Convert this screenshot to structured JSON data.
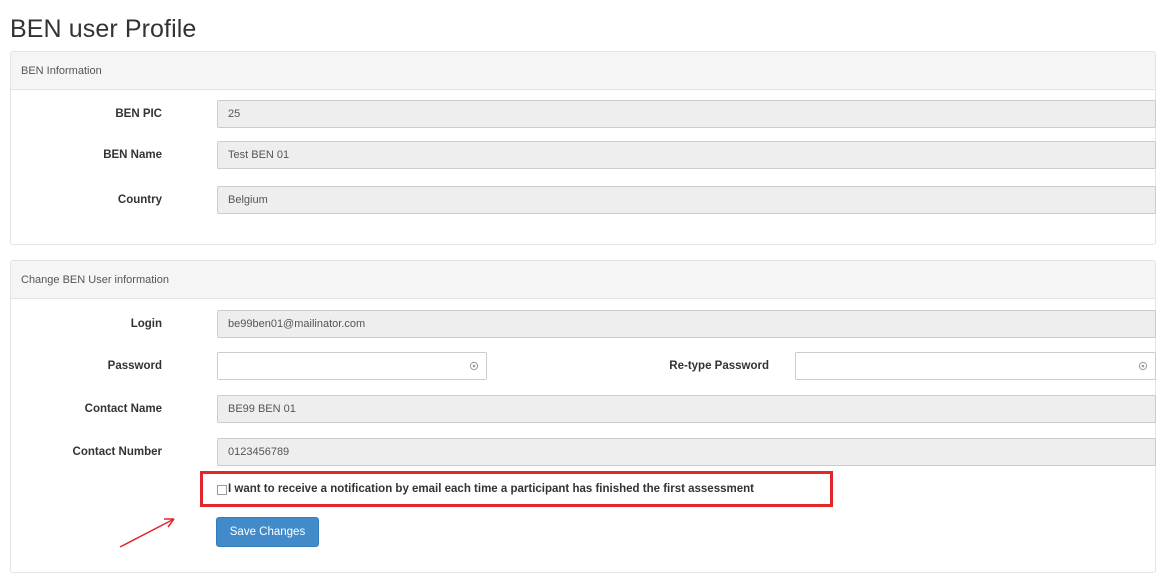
{
  "page": {
    "title": "BEN user Profile"
  },
  "ben_info": {
    "heading": "BEN Information",
    "fields": [
      {
        "label": "BEN PIC",
        "value": "25"
      },
      {
        "label": "BEN Name",
        "value": "Test BEN 01"
      },
      {
        "label": "Country",
        "value": "Belgium"
      }
    ]
  },
  "user_info": {
    "heading": "Change BEN User information",
    "login": {
      "label": "Login",
      "value": "be99ben01@mailinator.com"
    },
    "password": {
      "label": "Password",
      "value": ""
    },
    "retype_password": {
      "label": "Re-type Password",
      "value": ""
    },
    "contact_name": {
      "label": "Contact Name",
      "value": "BE99 BEN 01"
    },
    "contact_number": {
      "label": "Contact Number",
      "value": "0123456789"
    },
    "notification": {
      "label": "I want to receive a notification by email each time a participant has finished the first assessment",
      "checked": false
    },
    "save_label": "Save Changes"
  },
  "colors": {
    "accent": "#428bca",
    "highlight_box": "#e2262a",
    "readonly_bg": "#eeeeee",
    "panel_heading_bg": "#f5f5f5"
  },
  "icons": {
    "password_toggle": "eye-icon",
    "annotation": "red-arrow"
  }
}
